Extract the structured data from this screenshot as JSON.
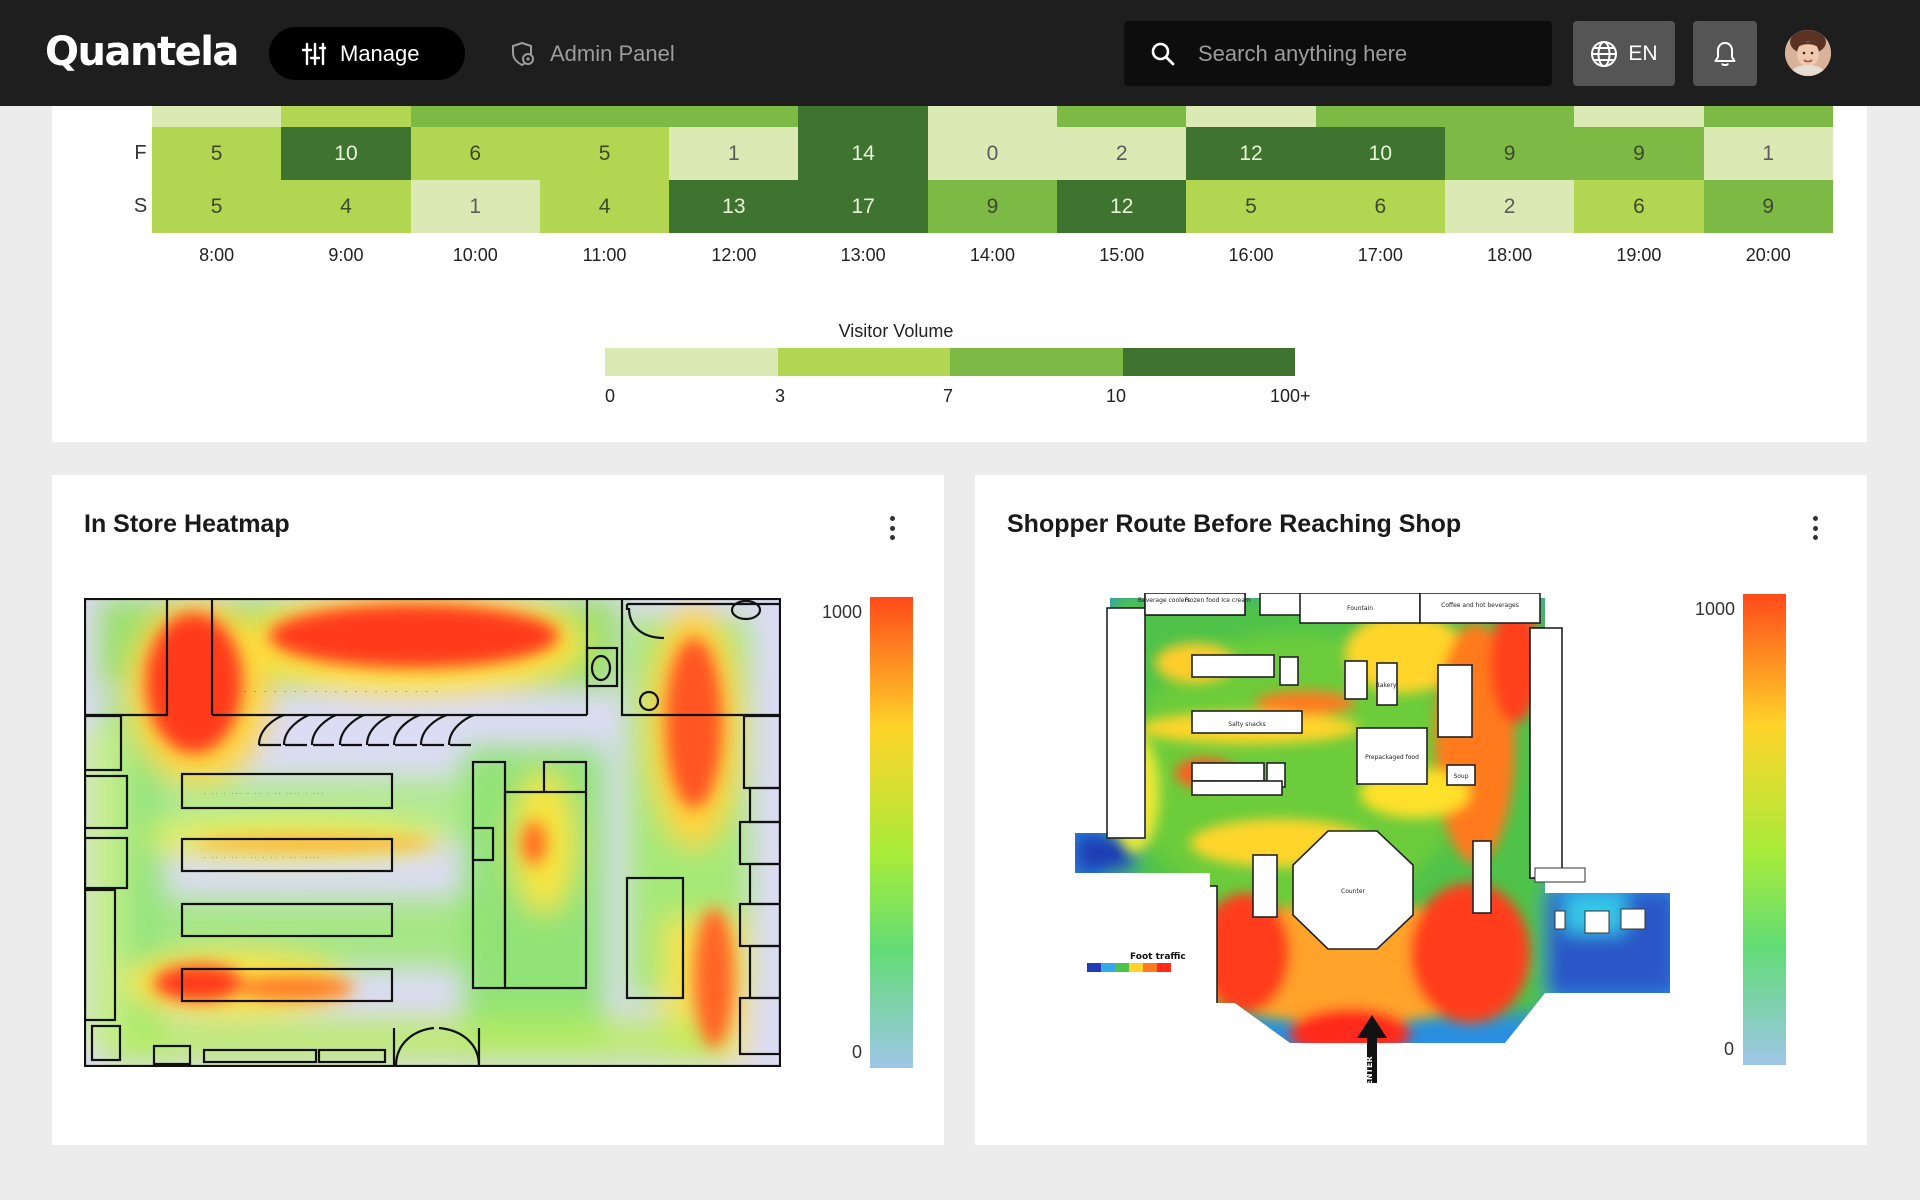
{
  "header": {
    "logo": "Quantela",
    "manage_label": "Manage",
    "admin_label": "Admin Panel",
    "search_placeholder": "Search anything here",
    "language": "EN"
  },
  "week_heatmap": {
    "rows": [
      {
        "label": "F",
        "values": [
          5,
          10,
          6,
          5,
          1,
          14,
          0,
          2,
          12,
          10,
          9,
          9,
          1
        ]
      },
      {
        "label": "S",
        "values": [
          5,
          4,
          1,
          4,
          13,
          17,
          9,
          12,
          5,
          6,
          2,
          6,
          9
        ]
      }
    ],
    "partial_row_colors": [
      "#dbeab5",
      "#b3d652",
      "#7dba45",
      "#7dba45",
      "#7dba45",
      "#3e7330",
      "#dbeab5",
      "#7dba45",
      "#dbeab5",
      "#7dba45",
      "#7dba45",
      "#dbeab5",
      "#7dba45"
    ],
    "hours": [
      "8:00",
      "9:00",
      "10:00",
      "11:00",
      "12:00",
      "13:00",
      "14:00",
      "15:00",
      "16:00",
      "17:00",
      "18:00",
      "19:00",
      "20:00"
    ],
    "legend": {
      "title": "Visitor Volume",
      "ticks": [
        "0",
        "3",
        "7",
        "10",
        "100+"
      ],
      "colors": [
        "#dbeab5",
        "#b3d652",
        "#7dba45",
        "#3e7330"
      ]
    }
  },
  "in_store": {
    "title": "In Store Heatmap",
    "scale_max": "1000",
    "scale_min": "0"
  },
  "shopper_route": {
    "title": "Shopper Route Before Reaching Shop",
    "scale_max": "1000",
    "scale_min": "0",
    "map_labels": {
      "beverage_coolers": "Beverage coolers",
      "frozen_food": "Frozen food",
      "ice_cream": "Ice cream",
      "fountain": "Fountain",
      "coffee": "Coffee and hot beverages",
      "bakery": "Bakery",
      "prepackaged": "Prepackaged food",
      "soup": "Soup",
      "counter": "Counter",
      "salty_snacks": "Salty snacks",
      "foot_traffic": "Foot traffic",
      "enter": "ENTER"
    }
  }
}
